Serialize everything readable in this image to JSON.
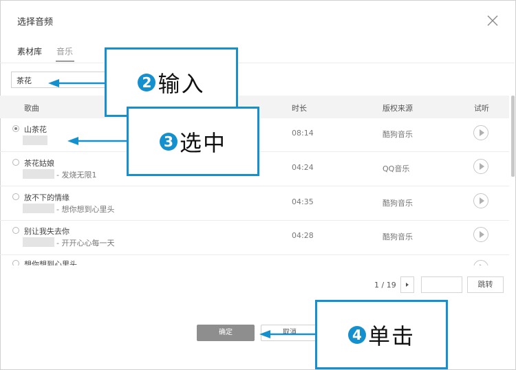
{
  "dialog": {
    "title": "选择音频",
    "tabs": [
      {
        "label": "素材库",
        "active": false
      },
      {
        "label": "音乐",
        "active": true
      }
    ],
    "search": {
      "value": "茶花"
    },
    "columns": [
      "歌曲",
      "时长",
      "版权来源",
      "试听"
    ],
    "rows": [
      {
        "title": "山茶花",
        "artist": "",
        "duration": "08:14",
        "source": "酷狗音乐",
        "selected": true
      },
      {
        "title": "茶花姑娘",
        "artist": "- 发烧无限1",
        "duration": "04:24",
        "source": "QQ音乐",
        "selected": false
      },
      {
        "title": "放不下的情缘",
        "artist": "- 想你想到心里头",
        "duration": "04:35",
        "source": "酷狗音乐",
        "selected": false
      },
      {
        "title": "别让我失去你",
        "artist": "- 开开心心每一天",
        "duration": "04:28",
        "source": "酷狗音乐",
        "selected": false
      },
      {
        "title": "想你想到心里头",
        "artist": "",
        "duration": "",
        "source": "",
        "selected": false
      }
    ],
    "pagination": {
      "text": "1 / 19",
      "next_icon": "chevron-right-icon",
      "jump_label": "跳转",
      "jump_value": ""
    },
    "buttons": {
      "ok": "确定",
      "cancel": "取消"
    }
  },
  "annotations": [
    {
      "num": "2",
      "text": "输入"
    },
    {
      "num": "3",
      "text": "选中"
    },
    {
      "num": "4",
      "text": "单击"
    }
  ],
  "colors": {
    "accent": "#1590cf",
    "ok_button": "#8e8e8e"
  }
}
